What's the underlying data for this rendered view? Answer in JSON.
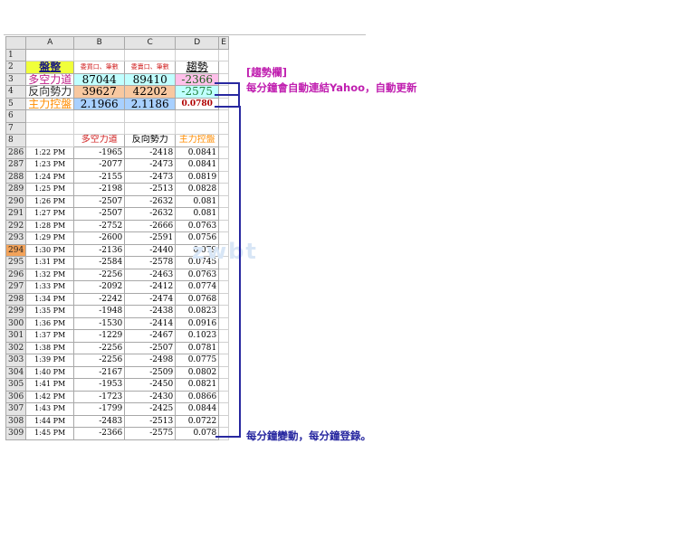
{
  "columns": [
    "",
    "A",
    "B",
    "C",
    "D",
    "E"
  ],
  "header_rows": [
    {
      "row": "1"
    },
    {
      "row": "2",
      "a": "盤整",
      "b": "委買口、筆數",
      "c": "委賣口、筆數",
      "d": "趨勢"
    },
    {
      "row": "3",
      "a": "多空力道",
      "b": "87044",
      "c": "89410",
      "d": "-2366"
    },
    {
      "row": "4",
      "a": "反向勢力",
      "b": "39627",
      "c": "42202",
      "d": "-2575"
    },
    {
      "row": "5",
      "a": "主力控盤",
      "b": "2.1966",
      "c": "2.1186",
      "d": "0.0780"
    },
    {
      "row": "6"
    },
    {
      "row": "7"
    },
    {
      "row": "8",
      "b": "多空力道",
      "c": "反向勢力",
      "d": "主力控盤"
    }
  ],
  "data_rows": [
    [
      "286",
      "1:22 PM",
      "-1965",
      "-2418",
      "0.0841"
    ],
    [
      "287",
      "1:23 PM",
      "-2077",
      "-2473",
      "0.0841"
    ],
    [
      "288",
      "1:24 PM",
      "-2155",
      "-2473",
      "0.0819"
    ],
    [
      "289",
      "1:25 PM",
      "-2198",
      "-2513",
      "0.0828"
    ],
    [
      "290",
      "1:26 PM",
      "-2507",
      "-2632",
      "0.081"
    ],
    [
      "291",
      "1:27 PM",
      "-2507",
      "-2632",
      "0.081"
    ],
    [
      "292",
      "1:28 PM",
      "-2752",
      "-2666",
      "0.0763"
    ],
    [
      "293",
      "1:29 PM",
      "-2600",
      "-2591",
      "0.0756"
    ],
    [
      "294",
      "1:30 PM",
      "-2136",
      "-2440",
      "0.079"
    ],
    [
      "295",
      "1:31 PM",
      "-2584",
      "-2578",
      "0.0745"
    ],
    [
      "296",
      "1:32 PM",
      "-2256",
      "-2463",
      "0.0763"
    ],
    [
      "297",
      "1:33 PM",
      "-2092",
      "-2412",
      "0.0774"
    ],
    [
      "298",
      "1:34 PM",
      "-2242",
      "-2474",
      "0.0768"
    ],
    [
      "299",
      "1:35 PM",
      "-1948",
      "-2438",
      "0.0823"
    ],
    [
      "300",
      "1:36 PM",
      "-1530",
      "-2414",
      "0.0916"
    ],
    [
      "301",
      "1:37 PM",
      "-1229",
      "-2467",
      "0.1023"
    ],
    [
      "302",
      "1:38 PM",
      "-2256",
      "-2507",
      "0.0781"
    ],
    [
      "303",
      "1:39 PM",
      "-2256",
      "-2498",
      "0.0775"
    ],
    [
      "304",
      "1:40 PM",
      "-2167",
      "-2509",
      "0.0802"
    ],
    [
      "305",
      "1:41 PM",
      "-1953",
      "-2450",
      "0.0821"
    ],
    [
      "306",
      "1:42 PM",
      "-1723",
      "-2430",
      "0.0866"
    ],
    [
      "307",
      "1:43 PM",
      "-1799",
      "-2425",
      "0.0844"
    ],
    [
      "308",
      "1:44 PM",
      "-2483",
      "-2513",
      "0.0722"
    ],
    [
      "309",
      "1:45 PM",
      "-2366",
      "-2575",
      "0.078"
    ]
  ],
  "selected_row": "294",
  "annotations": {
    "trend_title": "[趨勢欄]",
    "trend_desc": "每分鐘會自動連結Yahoo，自動更新",
    "minute_desc": "每分鐘變動，每分鐘登錄。"
  },
  "watermark": "zwbt",
  "colors": {
    "title_bg": "#f0ff3a",
    "cyan": "#c0ffff",
    "peach": "#f8c8a0",
    "blue": "#a8d0ff",
    "pink": "#ffc0ea",
    "line": "#2828a0",
    "annot_pink": "#c020b0",
    "selected_row": "#f3a35a"
  }
}
